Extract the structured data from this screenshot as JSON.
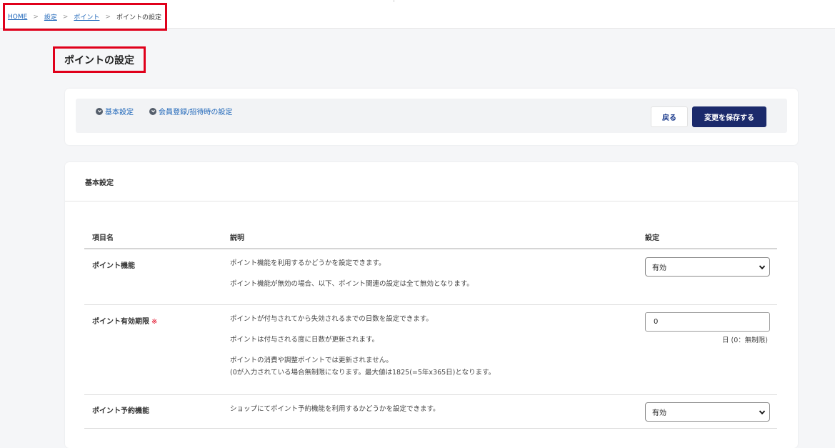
{
  "breadcrumb": {
    "items": [
      "HOME",
      "設定",
      "ポイント"
    ],
    "separator": ">",
    "current": "ポイントの設定"
  },
  "page": {
    "title": "ポイントの設定"
  },
  "nav": {
    "links": [
      "基本設定",
      "会員登録/招待時の設定"
    ],
    "back_label": "戻る",
    "save_label": "変更を保存する"
  },
  "section": {
    "title": "基本設定",
    "columns": [
      "項目名",
      "説明",
      "設定"
    ],
    "rows": [
      {
        "label": "ポイント機能",
        "descriptions": [
          "ポイント機能を利用するかどうかを設定できます。",
          "ポイント機能が無効の場合、以下、ポイント関連の設定は全て無効となります。"
        ],
        "control": "select",
        "value": "有効"
      },
      {
        "label": "ポイント有効期限",
        "required_mark": "※",
        "descriptions": [
          "ポイントが付与されてから失効されるまでの日数を設定できます。",
          "ポイントは付与される度に日数が更新されます。",
          "ポイントの消費や調整ポイントでは更新されません。",
          "(0が入力されている場合無制限になります。最大値は1825(=5年x365日)となります。"
        ],
        "control": "input",
        "value": "0",
        "hint": "日 (0：無制限)"
      },
      {
        "label": "ポイント予約機能",
        "descriptions": [
          "ショップにてポイント予約機能を利用するかどうかを設定できます。"
        ],
        "control": "select",
        "value": "有効"
      }
    ]
  },
  "colors": {
    "accent": "#1b2a6b",
    "link": "#1a63b8",
    "highlight_border": "#e0001b"
  }
}
